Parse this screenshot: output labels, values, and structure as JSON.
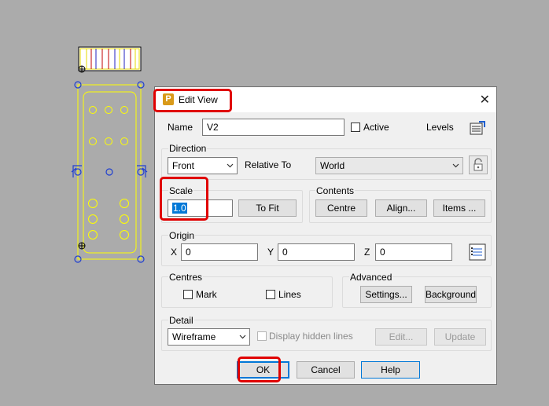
{
  "dialog": {
    "title": "Edit View",
    "name_label": "Name",
    "name_value": "V2",
    "active_label": "Active",
    "levels_label": "Levels",
    "direction": {
      "group_label": "Direction",
      "selected": "Front",
      "relative_to_label": "Relative To",
      "relative_to_value": "World"
    },
    "scale": {
      "group_label": "Scale",
      "value": "1.0",
      "to_fit_label": "To Fit"
    },
    "contents": {
      "group_label": "Contents",
      "centre_label": "Centre",
      "align_label": "Align...",
      "items_label": "Items ..."
    },
    "origin": {
      "group_label": "Origin",
      "x_label": "X",
      "x_value": "0",
      "y_label": "Y",
      "y_value": "0",
      "z_label": "Z",
      "z_value": "0"
    },
    "centres": {
      "group_label": "Centres",
      "mark_label": "Mark",
      "lines_label": "Lines"
    },
    "advanced": {
      "group_label": "Advanced",
      "settings_label": "Settings...",
      "background_label": "Background"
    },
    "detail": {
      "group_label": "Detail",
      "selected": "Wireframe",
      "display_hidden_lines_label": "Display hidden lines",
      "edit_label": "Edit...",
      "update_label": "Update"
    },
    "buttons": {
      "ok_label": "OK",
      "cancel_label": "Cancel",
      "help_label": "Help"
    }
  },
  "colors": {
    "canvas_bg": "#ababab",
    "drawing_yellow": "#ffff00",
    "handle_blue": "#1f3fd0",
    "highlight_red": "#e00000",
    "accent_blue": "#0078d7"
  },
  "icons": [
    "app-icon",
    "close-icon",
    "levels-icon",
    "lock-icon",
    "coordinates-icon",
    "chevron-down-icon"
  ]
}
